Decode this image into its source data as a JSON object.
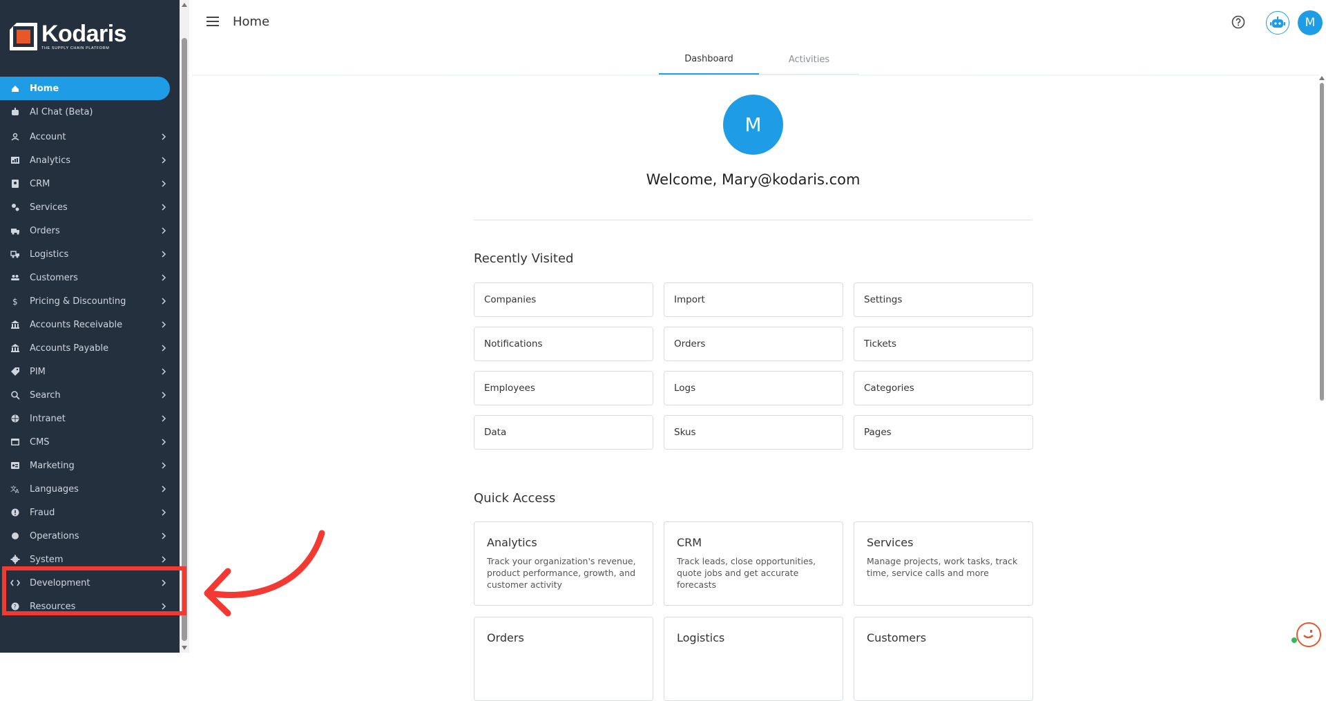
{
  "brand": {
    "name": "Kodaris",
    "tagline": "THE SUPPLY CHAIN PLATFORM"
  },
  "sidebar": {
    "items": [
      {
        "label": "Home",
        "icon": "home-icon",
        "active": true,
        "expandable": false
      },
      {
        "label": "AI Chat (Beta)",
        "icon": "robot-icon",
        "active": false,
        "expandable": false
      },
      {
        "label": "Account",
        "icon": "person-icon",
        "expandable": true
      },
      {
        "label": "Analytics",
        "icon": "analytics-icon",
        "expandable": true
      },
      {
        "label": "CRM",
        "icon": "contact-card-icon",
        "expandable": true
      },
      {
        "label": "Services",
        "icon": "gears-icon",
        "expandable": true
      },
      {
        "label": "Orders",
        "icon": "truck-icon",
        "expandable": true
      },
      {
        "label": "Logistics",
        "icon": "delivery-icon",
        "expandable": true
      },
      {
        "label": "Customers",
        "icon": "people-icon",
        "expandable": true
      },
      {
        "label": "Pricing & Discounting",
        "icon": "dollar-icon",
        "expandable": true
      },
      {
        "label": "Accounts Receivable",
        "icon": "bank-icon",
        "expandable": true
      },
      {
        "label": "Accounts Payable",
        "icon": "bank-icon",
        "expandable": true
      },
      {
        "label": "PIM",
        "icon": "tag-icon",
        "expandable": true
      },
      {
        "label": "Search",
        "icon": "search-icon",
        "expandable": true
      },
      {
        "label": "Intranet",
        "icon": "globe-icon",
        "expandable": true
      },
      {
        "label": "CMS",
        "icon": "web-icon",
        "expandable": true
      },
      {
        "label": "Marketing",
        "icon": "id-card-icon",
        "expandable": true
      },
      {
        "label": "Languages",
        "icon": "translate-icon",
        "expandable": true
      },
      {
        "label": "Fraud",
        "icon": "alert-icon",
        "expandable": true
      },
      {
        "label": "Operations",
        "icon": "operations-icon",
        "expandable": true
      },
      {
        "label": "System",
        "icon": "gear-icon",
        "expandable": true
      },
      {
        "label": "Development",
        "icon": "code-icon",
        "expandable": true
      },
      {
        "label": "Resources",
        "icon": "help-icon",
        "expandable": true
      }
    ]
  },
  "header": {
    "title": "Home",
    "avatar_initial": "M"
  },
  "tabs": [
    {
      "label": "Dashboard",
      "active": true
    },
    {
      "label": "Activities",
      "active": false
    }
  ],
  "welcome": {
    "avatar_initial": "M",
    "text": "Welcome, Mary@kodaris.com"
  },
  "recently_visited": {
    "title": "Recently Visited",
    "items": [
      "Companies",
      "Import",
      "Settings",
      "Notifications",
      "Orders",
      "Tickets",
      "Employees",
      "Logs",
      "Categories",
      "Data",
      "Skus",
      "Pages"
    ]
  },
  "quick_access": {
    "title": "Quick Access",
    "cards": [
      {
        "title": "Analytics",
        "desc": "Track your organization's revenue, product performance, growth, and customer activity"
      },
      {
        "title": "CRM",
        "desc": "Track leads, close opportunities, quote jobs and get accurate forecasts"
      },
      {
        "title": "Services",
        "desc": "Manage projects, work tasks, track time, service calls and more"
      },
      {
        "title": "Orders",
        "desc": ""
      },
      {
        "title": "Logistics",
        "desc": ""
      },
      {
        "title": "Customers",
        "desc": ""
      }
    ]
  },
  "colors": {
    "sidebar_bg": "#25303f",
    "accent": "#1e9ce6",
    "annotation": "#f23a33"
  }
}
